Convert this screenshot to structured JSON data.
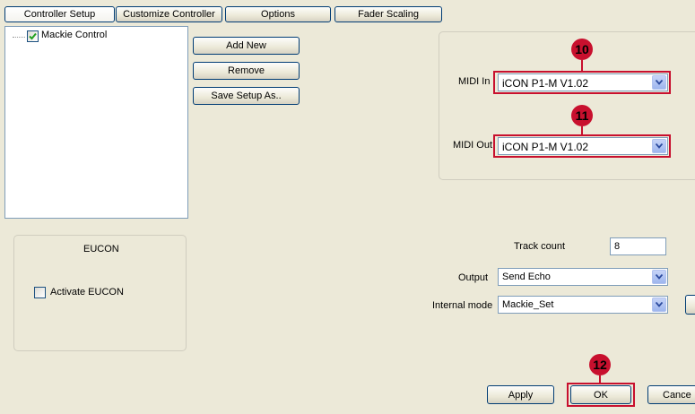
{
  "tabs": [
    "Controller Setup",
    "Customize Controller",
    "Options",
    "Fader Scaling"
  ],
  "tree": {
    "item_label": "Mackie Control"
  },
  "actions": {
    "add_new": "Add New",
    "remove": "Remove",
    "save_setup_as": "Save Setup As.."
  },
  "midi": {
    "in_label": "MIDI In",
    "in_value": "iCON P1-M V1.02",
    "out_label": "MIDI Out",
    "out_value": "iCON P1-M V1.02"
  },
  "eucon": {
    "title": "EUCON",
    "activate_label": "Activate EUCON"
  },
  "settings": {
    "track_count_label": "Track count",
    "track_count_value": "8",
    "output_label": "Output",
    "output_value": "Send Echo",
    "internal_mode_label": "Internal mode",
    "internal_mode_value": "Mackie_Set"
  },
  "footer": {
    "apply": "Apply",
    "ok": "OK",
    "cancel": "Cance"
  },
  "callouts": [
    "10",
    "11",
    "12"
  ],
  "colors": {
    "window_bg": "#ece9d8",
    "callout_red": "#c8102e",
    "border_blue": "#003c74"
  }
}
